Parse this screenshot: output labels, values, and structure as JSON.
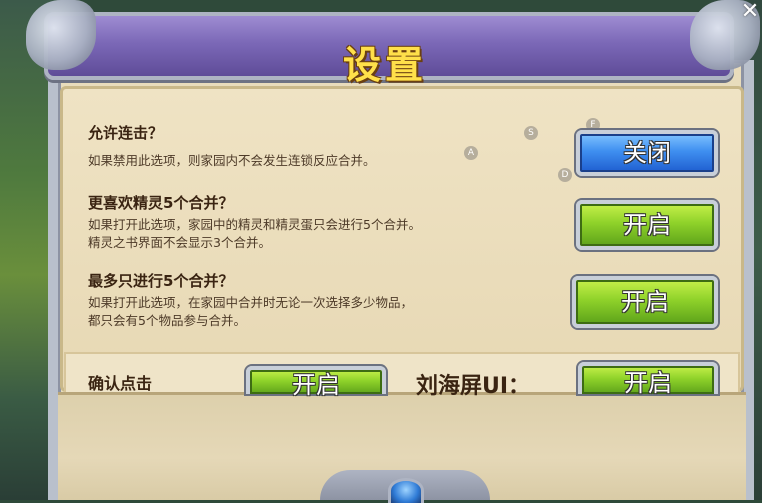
{
  "header": {
    "title": "设置"
  },
  "options": [
    {
      "title": "允许连击？",
      "desc": [
        "如果禁用此选项，则家园内不会发生连锁反应合并。"
      ],
      "button": "关闭",
      "state": "off"
    },
    {
      "title": "更喜欢精灵5个合并？",
      "desc": [
        "如果打开此选项，家园中的精灵和精灵蛋只会进行5个合并。",
        "精灵之书界面不会显示3个合并。"
      ],
      "button": "开启",
      "state": "on"
    },
    {
      "title": "最多只进行5个合并？",
      "desc": [
        "如果打开此选项，在家园中合并时无论一次选择多少物品，",
        "都只会有5个物品参与合并。"
      ],
      "button": "开启",
      "state": "on"
    }
  ],
  "lower": {
    "confirm_label": "确认点击",
    "confirm_button": "开启",
    "notch_label": "刘海屏UI：",
    "notch_button": "开启"
  },
  "hints": {
    "a": "A",
    "s": "S",
    "f": "F",
    "d": "D"
  },
  "close_icon": "close-icon",
  "colors": {
    "title": "#ffe04a",
    "header": "#7b68b7",
    "on_button": "#8fd22a",
    "off_button": "#3f8ff0",
    "panel": "#e8dcbc"
  }
}
